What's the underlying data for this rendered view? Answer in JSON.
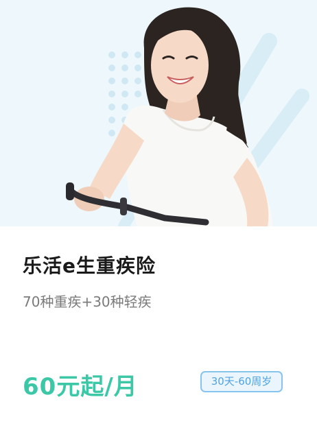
{
  "product": {
    "image_alt": "smiling woman riding a bicycle",
    "title": "乐活e生重疾险",
    "coverage": "70种重疾+30种轻疾",
    "price": "60元起/月",
    "age_range": "30天-60周岁"
  },
  "colors": {
    "price": "#3cc8a7",
    "badge_border": "#86c4ee",
    "badge_text": "#4fa3e3",
    "hero_background": "#eef8fc"
  }
}
